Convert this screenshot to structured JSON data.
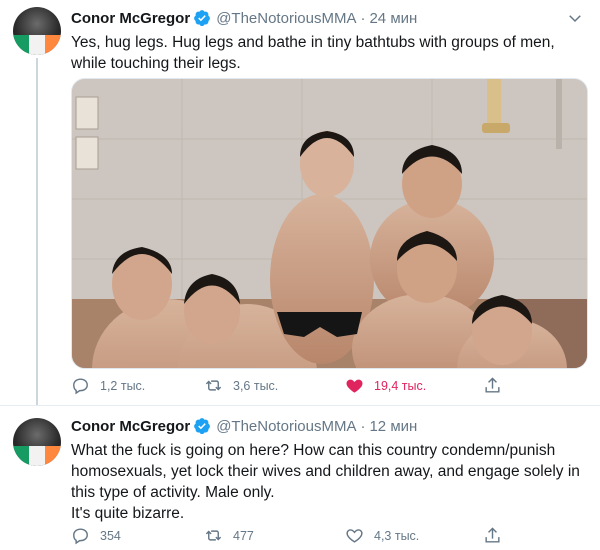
{
  "tweets": [
    {
      "author_name": "Conor McGregor",
      "handle": "@TheNotoriousMMA",
      "dot": "·",
      "time": "24 мин",
      "text": "Yes, hug legs. Hug legs and bathe in tiny bathtubs with groups of men, while touching their legs.",
      "media": "photo-of-men-in-bathtub",
      "replies": "1,2 тыс.",
      "retweets": "3,6 тыс.",
      "likes": "19,4 тыс.",
      "liked": true
    },
    {
      "author_name": "Conor McGregor",
      "handle": "@TheNotoriousMMA",
      "dot": "·",
      "time": "12 мин",
      "text": "What the fuck is going on here? How can this country condemn/punish homosexuals, yet lock their wives and children away, and engage solely in this type of activity. Male only.\nIt's quite bizarre.",
      "replies": "354",
      "retweets": "477",
      "likes": "4,3 тыс.",
      "liked": false
    }
  ],
  "colors": {
    "text": "#14171a",
    "secondary": "#657786",
    "verified": "#1da1f2",
    "like_active": "#e0245e",
    "divider": "#e6ecf0"
  },
  "icons": [
    "verified-badge-icon",
    "chevron-down-icon",
    "reply-icon",
    "retweet-icon",
    "heart-icon",
    "share-icon"
  ]
}
